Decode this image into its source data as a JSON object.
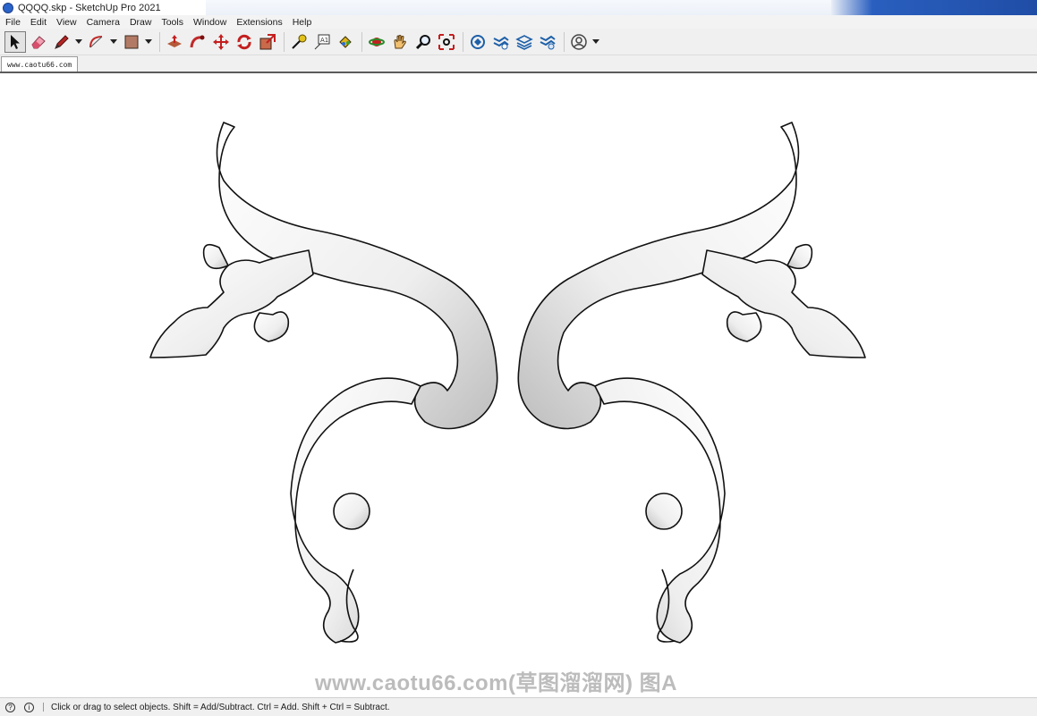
{
  "window": {
    "title": "QQQQ.skp - SketchUp Pro 2021"
  },
  "menu": [
    "File",
    "Edit",
    "View",
    "Camera",
    "Draw",
    "Tools",
    "Window",
    "Extensions",
    "Help"
  ],
  "toolbar": {
    "icons": [
      "select-icon",
      "eraser-icon",
      "pencil-icon",
      "arc-icon",
      "paint-bucket-icon",
      "push-pull-icon",
      "follow-me-icon",
      "move-icon",
      "rotate-icon",
      "offset-icon",
      "tape-measure-icon",
      "text-icon",
      "3d-text-icon",
      "orbit-icon",
      "pan-icon",
      "zoom-icon",
      "zoom-extents-icon",
      "warehouse-icon",
      "extension-warehouse-icon",
      "layout-icon",
      "extension-manager-icon",
      "account-icon"
    ]
  },
  "tabs": {
    "active": "www.caotu66.com"
  },
  "viewport": {
    "model_description": "ornamental carved acanthus scroll pair",
    "watermark": "www.caotu66.com(草图溜溜网) 图A"
  },
  "status": {
    "text": "Click or drag to select objects. Shift = Add/Subtract. Ctrl = Add. Shift + Ctrl = Subtract."
  },
  "colors": {
    "viewport_bg": "#ffffff",
    "ornament_fill": "#f4f4f4",
    "ornament_edge": "#111111"
  }
}
